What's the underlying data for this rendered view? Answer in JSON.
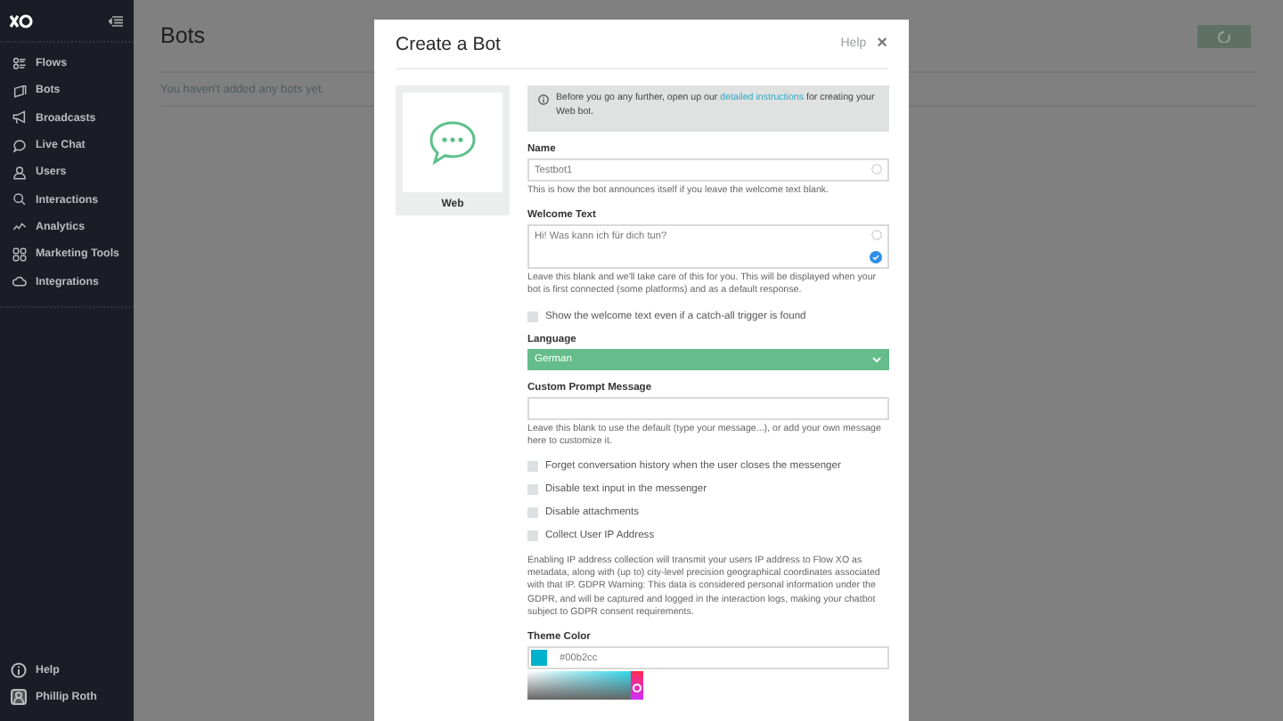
{
  "sidebar": {
    "items": [
      {
        "label": "Flows"
      },
      {
        "label": "Bots"
      },
      {
        "label": "Broadcasts"
      },
      {
        "label": "Live Chat"
      },
      {
        "label": "Users"
      },
      {
        "label": "Interactions"
      },
      {
        "label": "Analytics"
      },
      {
        "label": "Marketing Tools"
      },
      {
        "label": "Integrations"
      }
    ],
    "footer": [
      {
        "label": "Help"
      },
      {
        "label": "Phillip Roth"
      }
    ]
  },
  "page": {
    "title": "Bots",
    "empty_message": "You haven't added any bots yet."
  },
  "modal": {
    "title": "Create a Bot",
    "help": "Help",
    "close": "×",
    "platform": {
      "label": "Web"
    },
    "info": {
      "before": "Before you go any further, open up our ",
      "link": "detailed instructions",
      "after": " for creating your Web bot."
    },
    "fields": [
      {
        "kind": "text",
        "label": "Name",
        "value": "Testbot1",
        "hint": "This is how the bot announces itself if you leave the welcome text blank."
      },
      {
        "kind": "textarea",
        "label": "Welcome Text",
        "value": "Hi! Was kann ich für dich tun?",
        "hint": "Leave this blank and we'll take care of this for you. This will be displayed when your bot is first connected (some platforms) and as a default response."
      },
      {
        "kind": "checkbox",
        "label": "Show the welcome text even if a catch-all trigger is found",
        "checked": false
      },
      {
        "kind": "select",
        "label": "Language",
        "value": "German"
      },
      {
        "kind": "text",
        "label": "Custom Prompt Message",
        "hint": "Leave this blank to use the default (type your message...), or add your own message here to customize it."
      },
      {
        "kind": "checkbox",
        "label": "Forget conversation history when the user closes the messenger",
        "checked": false
      },
      {
        "kind": "checkbox",
        "label": "Disable text input in the messenger",
        "checked": false
      },
      {
        "kind": "checkbox",
        "label": "Disable attachments",
        "checked": false
      },
      {
        "kind": "checkbox",
        "label": "Collect User IP Address",
        "checked": false
      },
      {
        "kind": "paragraph",
        "text": "Enabling IP address collection will transmit your users IP address to Flow XO as metadata, along with (up to) city-level precision geographical coordinates associated with that IP. GDPR Warning: This data is considered personal information under the GDPR, and will be captured and logged in the interaction logs, making your chatbot subject to GDPR consent requirements."
      },
      {
        "kind": "color",
        "label": "Theme Color",
        "value": "#00b2cc",
        "color": "#00b2cc"
      }
    ]
  }
}
